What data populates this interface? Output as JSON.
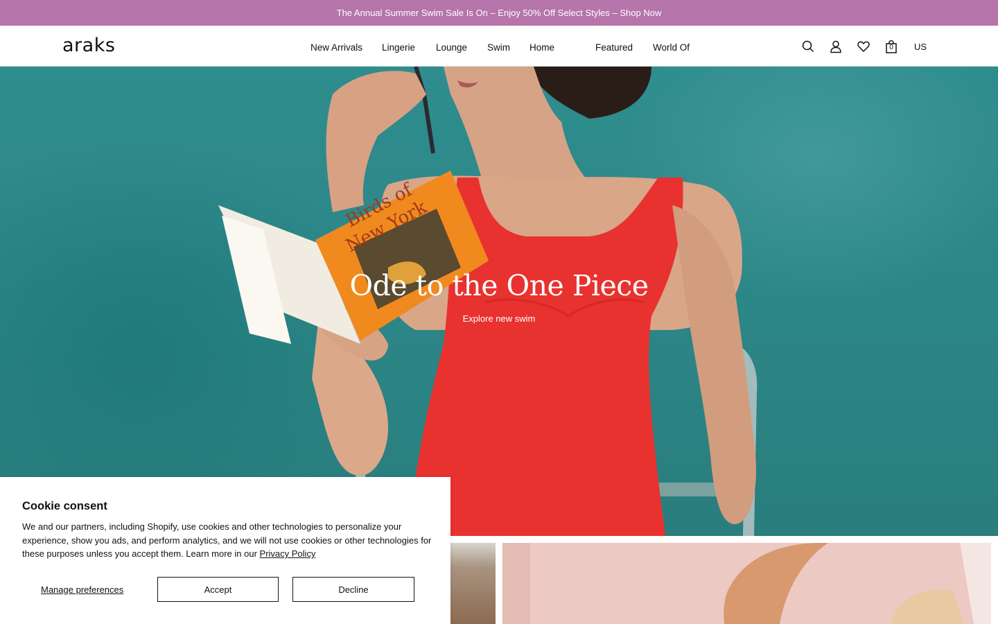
{
  "announcement": {
    "text": "The Annual Summer Swim Sale Is On – Enjoy 50% Off Select Styles – Shop Now"
  },
  "header": {
    "logo": "araks",
    "nav": [
      {
        "label": "New Arrivals"
      },
      {
        "label": "Lingerie"
      },
      {
        "label": "Lounge"
      },
      {
        "label": "Swim"
      },
      {
        "label": "Home"
      },
      {
        "label": "Featured"
      },
      {
        "label": "World Of"
      }
    ],
    "icons": [
      "search-icon",
      "account-icon",
      "wishlist-heart-icon",
      "bag-icon"
    ],
    "bag_count": "0",
    "locale": "US"
  },
  "hero": {
    "title": "Ode to the One Piece",
    "cta": "Explore new swim"
  },
  "cookie": {
    "title": "Cookie consent",
    "body": "We and our partners, including Shopify, use cookies and other technologies to personalize your experience, show you ads, and perform analytics, and we will not use cookies or other technologies for these purposes unless you accept them. Learn more in our ",
    "privacy_link": "Privacy Policy",
    "manage_label": "Manage preferences",
    "accept_label": "Accept",
    "decline_label": "Decline"
  },
  "colors": {
    "announcement_bg": "#b574aa",
    "hero_bg": "#2f8d8e",
    "swimsuit": "#e8322f",
    "tile_pink": "#ecc9c3"
  }
}
